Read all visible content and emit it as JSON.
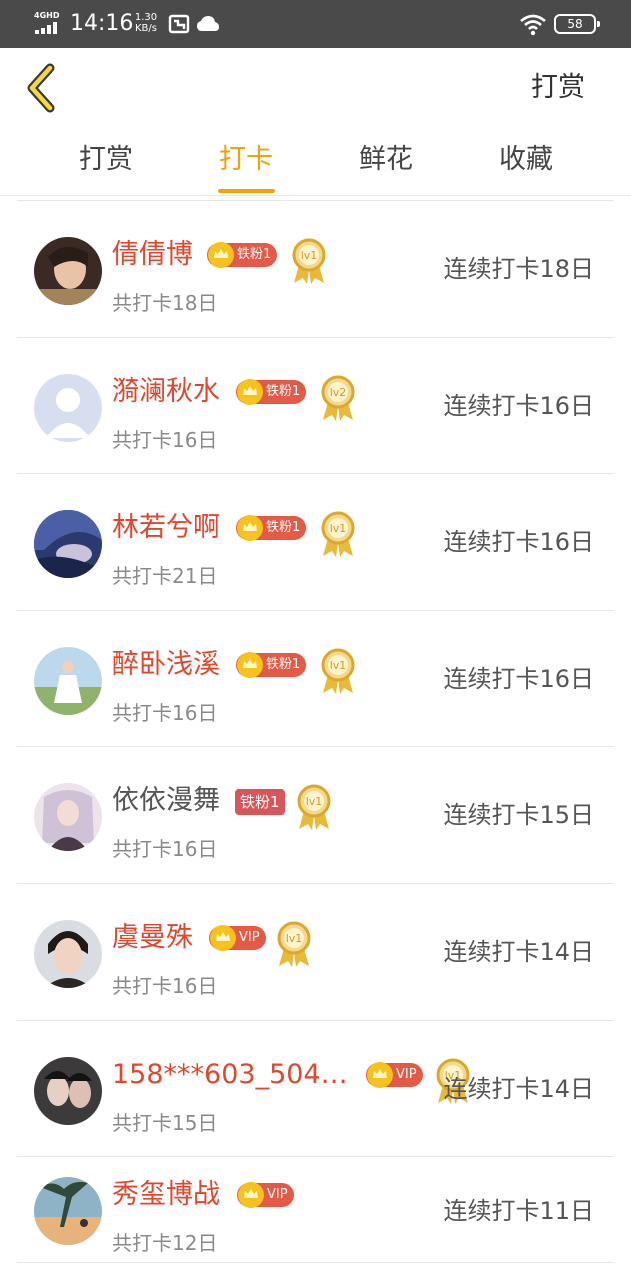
{
  "status_bar": {
    "network": "4GHD",
    "time": "14:16",
    "speed_value": "1.30",
    "speed_unit": "KB/s",
    "battery": "58"
  },
  "header": {
    "back_icon": "chevron-left-icon",
    "action_label": "打赏",
    "accent_color": "#f2a20c"
  },
  "tabs": [
    {
      "label": "打赏",
      "active": false
    },
    {
      "label": "打卡",
      "active": true
    },
    {
      "label": "鲜花",
      "active": false
    },
    {
      "label": "收藏",
      "active": false
    }
  ],
  "list": [
    {
      "name": "倩倩博",
      "fan_badge": "铁粉1",
      "level": "lv1",
      "total": "共打卡18日",
      "streak": "连续打卡18日"
    },
    {
      "name": "漪澜秋水",
      "fan_badge": "铁粉1",
      "level": "lv2",
      "total": "共打卡16日",
      "streak": "连续打卡16日"
    },
    {
      "name": "林若兮啊",
      "fan_badge": "铁粉1",
      "level": "lv1",
      "total": "共打卡21日",
      "streak": "连续打卡16日"
    },
    {
      "name": "醉卧浅溪",
      "fan_badge": "铁粉1",
      "level": "lv1",
      "total": "共打卡16日",
      "streak": "连续打卡16日"
    },
    {
      "name": "依依漫舞",
      "fan_badge": "铁粉1",
      "level": "lv1",
      "total": "共打卡16日",
      "streak": "连续打卡15日"
    },
    {
      "name": "虞曼殊",
      "fan_badge": "VIP",
      "level": "lv1",
      "total": "共打卡16日",
      "streak": "连续打卡14日"
    },
    {
      "name": "158***603_504…",
      "fan_badge": "VIP",
      "level": "lv1",
      "total": "共打卡15日",
      "streak": "连续打卡14日"
    },
    {
      "name": "秀玺博战",
      "fan_badge": "VIP",
      "total": "共打卡12日",
      "streak": "连续打卡11日"
    }
  ]
}
